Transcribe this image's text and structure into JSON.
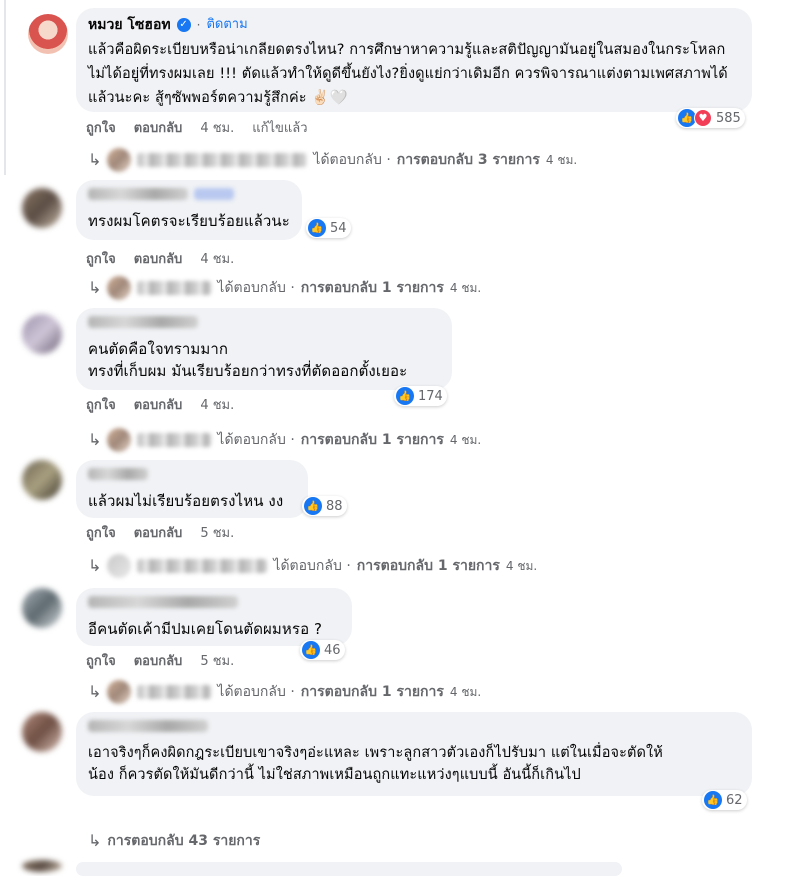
{
  "post_author": {
    "name": "หมวย โซฮอท",
    "follow_label": "ติดตาม",
    "dot": "·"
  },
  "main_comment": {
    "text": "แล้วคือผิดระเบียบหรือน่าเกลียดตรงไหน? การศึกษาหาความรู้และสติปัญญามันอยู่ในสมองในกระโหลก ไม่ได้อยู่ที่ทรงผมเลย !!! ตัดแล้วทำให้ดูดีขึ้นยังไง?ยิ่งดูแย่กว่าเดิมอีก ควรพิจารณาแต่งตามเพศสภาพได้แล้วนะคะ สู้ๆซัพพอร์ตความรู้สึกค่ะ ✌🏻🤍",
    "reactions": "585",
    "like_label": "ถูกใจ",
    "reply_label": "ตอบกลับ",
    "time": "4 ชม.",
    "edited": "แก้ไขแล้ว",
    "reply_summary": {
      "prefix": "ได้ตอบกลับ · ",
      "count": "การตอบกลับ 3 รายการ",
      "time": "4 ชม."
    }
  },
  "comments": [
    {
      "text": "ทรงผมโคตรจะเรียบร้อยแล้วนะ",
      "reactions": "54",
      "like_label": "ถูกใจ",
      "reply_label": "ตอบกลับ",
      "time": "4 ชม.",
      "reply_prefix": "ได้ตอบกลับ · ",
      "reply_count": "การตอบกลับ 1 รายการ",
      "reply_time": "4 ชม."
    },
    {
      "text_line1": "คนตัดคือใจทรามมาก",
      "text_line2": "ทรงที่เก็บผม มันเรียบร้อยกว่าทรงที่ตัดออกตั้งเยอะ",
      "reactions": "174",
      "like_label": "ถูกใจ",
      "reply_label": "ตอบกลับ",
      "time": "4 ชม.",
      "reply_prefix": "ได้ตอบกลับ · ",
      "reply_count": "การตอบกลับ 1 รายการ",
      "reply_time": "4 ชม."
    },
    {
      "text": "แล้วผมไม่เรียบร้อยตรงไหน งง",
      "reactions": "88",
      "like_label": "ถูกใจ",
      "reply_label": "ตอบกลับ",
      "time": "5 ชม.",
      "reply_prefix": "ได้ตอบกลับ · ",
      "reply_count": "การตอบกลับ 1 รายการ",
      "reply_time": "4 ชม."
    },
    {
      "text": "อีคนตัดเค้ามีปมเคยโดนตัดผมหรอ ?",
      "reactions": "46",
      "like_label": "ถูกใจ",
      "reply_label": "ตอบกลับ",
      "time": "5 ชม.",
      "reply_prefix": "ได้ตอบกลับ · ",
      "reply_count": "การตอบกลับ 1 รายการ",
      "reply_time": "4 ชม."
    },
    {
      "text_line1": "เอาจริงๆก็คงผิดกฎระเบียบเขาจริงๆอ่ะแหละ เพราะลูกสาวตัวเองก็ไปรับมา แต่ในเมื่อจะตัดให้",
      "text_line2": "น้อง ก็ควรตัดให้มันดีกว่านี้ ไม่ใช่สภาพเหมือนถูกแทะแหว่งๆแบบนี้ อันนี้ก็เกินไป",
      "reactions": "62",
      "reply_count": "การตอบกลับ 43 รายการ"
    }
  ]
}
